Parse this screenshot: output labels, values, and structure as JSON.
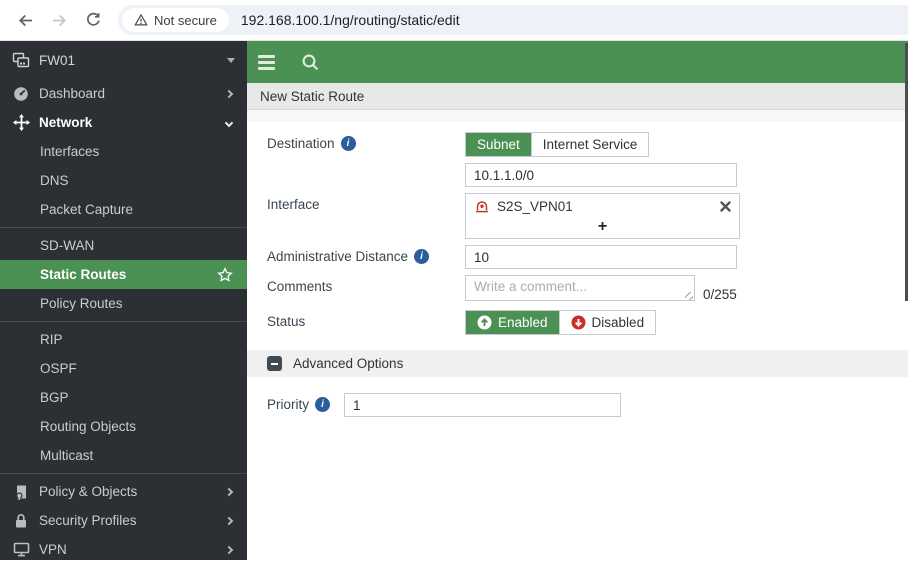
{
  "browser": {
    "security_label": "Not secure",
    "url": "192.168.100.1/ng/routing/static/edit"
  },
  "sidebar": {
    "device_name": "FW01",
    "top_items": [
      {
        "label": "Dashboard"
      },
      {
        "label": "Network"
      }
    ],
    "network_items": [
      {
        "label": "Interfaces"
      },
      {
        "label": "DNS"
      },
      {
        "label": "Packet Capture"
      },
      {
        "label": "SD-WAN"
      },
      {
        "label": "Static Routes"
      },
      {
        "label": "Policy Routes"
      },
      {
        "label": "RIP"
      },
      {
        "label": "OSPF"
      },
      {
        "label": "BGP"
      },
      {
        "label": "Routing Objects"
      },
      {
        "label": "Multicast"
      }
    ],
    "bottom_items": [
      {
        "label": "Policy & Objects"
      },
      {
        "label": "Security Profiles"
      },
      {
        "label": "VPN"
      }
    ],
    "selected_item": "Static Routes"
  },
  "breadcrumb": {
    "title": "New Static Route"
  },
  "form": {
    "destination": {
      "label": "Destination",
      "options": [
        "Subnet",
        "Internet Service"
      ],
      "selected": "Subnet",
      "value": "10.1.1.0/0"
    },
    "interface": {
      "label": "Interface",
      "selected_item": "S2S_VPN01",
      "add_label": "+"
    },
    "admin_distance": {
      "label": "Administrative Distance",
      "value": "10"
    },
    "comments": {
      "label": "Comments",
      "placeholder": "Write a comment...",
      "counter": "0/255"
    },
    "status": {
      "label": "Status",
      "options": [
        "Enabled",
        "Disabled"
      ],
      "selected": "Enabled"
    },
    "advanced": {
      "label": "Advanced Options"
    },
    "priority": {
      "label": "Priority",
      "value": "1"
    }
  },
  "colors": {
    "accent_green": "#4a9153",
    "sidebar_bg": "#2c3034",
    "status_red": "#c9302c",
    "info_blue": "#2a5d9b",
    "tunnel_red": "#c0392b"
  },
  "icons": {
    "warning": "triangle-exclamation",
    "info": "i-circle",
    "enabled": "arrow-up-circle",
    "disabled": "arrow-down-circle",
    "interface_type": "tunnel"
  }
}
